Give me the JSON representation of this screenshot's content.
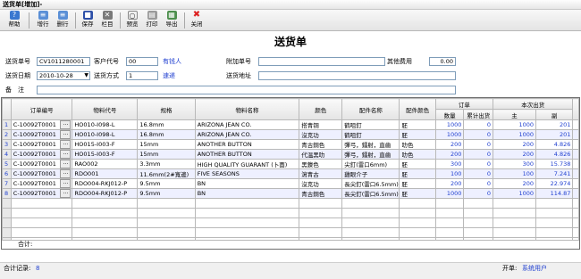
{
  "window": {
    "title": "送货单[增加]-"
  },
  "toolbar": {
    "buttons": [
      {
        "label": "帮助",
        "icon": "help-icon"
      },
      {
        "label": "增行",
        "icon": "add-row-icon"
      },
      {
        "label": "删行",
        "icon": "delete-row-icon"
      },
      {
        "label": "保存",
        "icon": "save-icon"
      },
      {
        "label": "栏目",
        "icon": "columns-icon"
      },
      {
        "label": "预览",
        "icon": "preview-icon"
      },
      {
        "label": "打印",
        "icon": "print-icon"
      },
      {
        "label": "导出",
        "icon": "export-icon"
      },
      {
        "label": "关闭",
        "icon": "close-icon"
      }
    ]
  },
  "form": {
    "title": "送货单",
    "doc_no_label": "送货单号",
    "doc_no": "CV1011280001",
    "customer_code_label": "客户代号",
    "customer_code": "00",
    "customer_name": "有钱人",
    "extra_no_label": "附加单号",
    "extra_no": "",
    "other_fee_label": "其他费用",
    "other_fee": "0.00",
    "date_label": "送货日期",
    "date": "2010-10-28",
    "method_label": "送货方式",
    "method_code": "1",
    "method_name": "速递",
    "address_label": "送货地址",
    "address": "",
    "remark_label": "备　注",
    "remark": ""
  },
  "grid": {
    "headers": {
      "order_no": "订单编号",
      "item_code": "物料代号",
      "spec": "规格",
      "item_name": "物料名称",
      "color": "颜色",
      "part_name": "配件名称",
      "part_color": "配件颜色",
      "order_group": "订单",
      "qty": "数量",
      "cum_out": "累计出货",
      "ship_group": "本次出货",
      "main": "主",
      "sub": "副"
    },
    "rows": [
      {
        "no": "1",
        "order_no": "C-10092T0001",
        "item_code": "HO010-I098-L",
        "spec": "16.8mm",
        "item_name": "ARIZONA JEAN CO.",
        "color": "搭青铜",
        "part_name": "鹤咀釘",
        "part_color": "胚",
        "qty": "1000",
        "cum_out": "0",
        "main": "1000",
        "sub": "201"
      },
      {
        "no": "2",
        "order_no": "C-10092T0001",
        "item_code": "HO010-I098-L",
        "spec": "16.8mm",
        "item_name": "ARIZONA JEAN CO.",
        "color": "沒克功",
        "part_name": "鹤咀釘",
        "part_color": "胚",
        "qty": "1000",
        "cum_out": "0",
        "main": "1000",
        "sub": "201"
      },
      {
        "no": "3",
        "order_no": "C-10092T0001",
        "item_code": "HO015-I003-F",
        "spec": "15mm",
        "item_name": "ANOTHER BUTTON",
        "color": "青古銅色",
        "part_name": "彈弓，鐳射，直齒",
        "part_color": "叻色",
        "qty": "200",
        "cum_out": "0",
        "main": "200",
        "sub": "4.826"
      },
      {
        "no": "4",
        "order_no": "C-10092T0001",
        "item_code": "HO015-I003-F",
        "spec": "15mm",
        "item_name": "ANOTHER BUTTON",
        "color": "代温黑叻",
        "part_name": "彈弓，鐳射，直齒",
        "part_color": "叻色",
        "qty": "200",
        "cum_out": "0",
        "main": "200",
        "sub": "4.826"
      },
      {
        "no": "5",
        "order_no": "C-10092T0001",
        "item_code": "RAO002",
        "spec": "3.3mm",
        "item_name": "HIGH QUALITY GUARANT (卜面)",
        "color": "黑鎳色",
        "part_name": "尖釘(雷口6mm)",
        "part_color": "胚",
        "qty": "300",
        "cum_out": "0",
        "main": "300",
        "sub": "15.738"
      },
      {
        "no": "6",
        "order_no": "C-10092T0001",
        "item_code": "RDO001",
        "spec": "11.6mm(2#寬邊)",
        "item_name": "FIVE SEASONS",
        "color": "瀉青古",
        "part_name": "雞眼介子",
        "part_color": "胚",
        "qty": "100",
        "cum_out": "0",
        "main": "100",
        "sub": "7.241"
      },
      {
        "no": "7",
        "order_no": "C-10092T0001",
        "item_code": "RDO004-RKJ012-P",
        "spec": "9.5mm",
        "item_name": "BN",
        "color": "沒克功",
        "part_name": "長尖釘(雷口6.5mm)",
        "part_color": "胚",
        "qty": "200",
        "cum_out": "0",
        "main": "200",
        "sub": "22.974"
      },
      {
        "no": "8",
        "order_no": "C-10092T0001",
        "item_code": "RDO004-RKJ012-P",
        "spec": "9.5mm",
        "item_name": "BN",
        "color": "青古銅色",
        "part_name": "長尖釘(雷口6.5mm)",
        "part_color": "胚",
        "qty": "1000",
        "cum_out": "0",
        "main": "1000",
        "sub": "114.87"
      }
    ],
    "sum_label": "合计:"
  },
  "status": {
    "record_label": "合计记录:",
    "record_count": "8",
    "user_label": "开单:",
    "user": "系统用户"
  }
}
